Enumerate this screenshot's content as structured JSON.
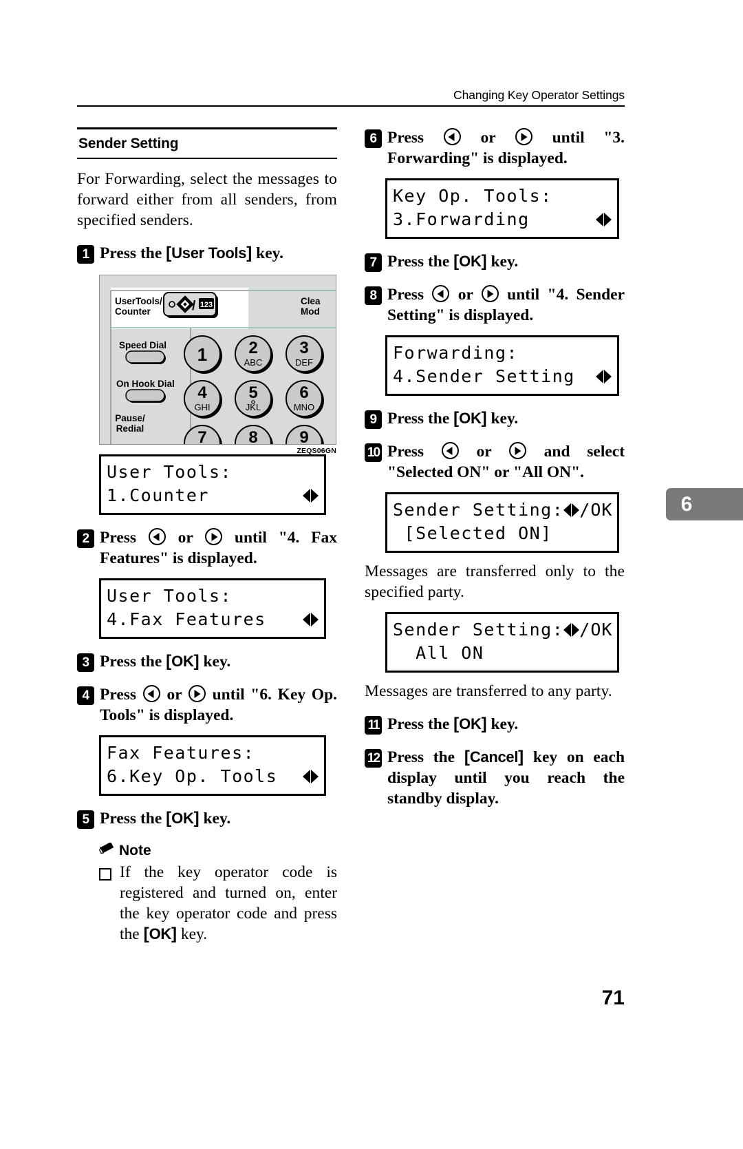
{
  "header": {
    "running_title": "Changing Key Operator Settings"
  },
  "chapter_tab": "6",
  "page_number": "71",
  "left_column": {
    "section_title": "Sender Setting",
    "intro_paragraph": "For Forwarding, select the messages to forward either from all senders, from specified senders.",
    "step1": {
      "num": "1",
      "text_before": "Press the",
      "key": "User Tools",
      "text_after": "key."
    },
    "illustration": {
      "caption": "ZEQS06GN",
      "label_user_tools": "UserTools/",
      "label_user_tools_2": "Counter",
      "label_clear": "Clea",
      "label_clear_2": "Mod",
      "label_speed_dial": "Speed Dial",
      "label_on_hook": "On Hook Dial",
      "label_pause": "Pause/",
      "label_pause_2": "Redial",
      "key_numeric_badge": "123",
      "keys": [
        {
          "digit": "1",
          "letters": ""
        },
        {
          "digit": "2",
          "letters": "ABC"
        },
        {
          "digit": "3",
          "letters": "DEF"
        },
        {
          "digit": "4",
          "letters": "GHI"
        },
        {
          "digit": "5",
          "letters": "JKL"
        },
        {
          "digit": "6",
          "letters": "MNO"
        },
        {
          "digit": "7",
          "letters": ""
        },
        {
          "digit": "8",
          "letters": ""
        },
        {
          "digit": "9",
          "letters": ""
        }
      ]
    },
    "lcd1": {
      "line1": "User Tools:",
      "line2": "1.Counter"
    },
    "step2": {
      "num": "2",
      "text_before": "Press",
      "text_mid": "or",
      "text_after": "until \"4. Fax Features\" is displayed."
    },
    "lcd2": {
      "line1": "User Tools:",
      "line2": "4.Fax Features"
    },
    "step3": {
      "num": "3",
      "text_before": "Press the",
      "key": "OK",
      "text_after": "key."
    },
    "step4": {
      "num": "4",
      "text_before": "Press",
      "text_mid": "or",
      "text_after": "until \"6. Key Op. Tools\" is displayed."
    },
    "lcd3": {
      "line1": "Fax Features:",
      "line2": "6.Key Op. Tools"
    },
    "step5": {
      "num": "5",
      "text_before": "Press the",
      "key": "OK",
      "text_after": "key."
    },
    "note": {
      "title": "Note",
      "item1_part1": "If the key operator code is registered and turned on, enter the key operator code and press the",
      "item1_key": "OK",
      "item1_part2": "key."
    }
  },
  "right_column": {
    "step6": {
      "num": "6",
      "text_before": "Press",
      "text_mid": "or",
      "text_after": "until \"3. Forwarding\" is displayed."
    },
    "lcd4": {
      "line1": "Key Op. Tools:",
      "line2": "3.Forwarding"
    },
    "step7": {
      "num": "7",
      "text_before": "Press the",
      "key": "OK",
      "text_after": "key."
    },
    "step8": {
      "num": "8",
      "text_before": "Press",
      "text_mid": "or",
      "text_after": "until \"4. Sender Setting\" is displayed."
    },
    "lcd5": {
      "line1": "Forwarding:",
      "line2": "4.Sender Setting"
    },
    "step9": {
      "num": "9",
      "text_before": "Press the",
      "key": "OK",
      "text_after": "key."
    },
    "step10": {
      "num": "10",
      "text_before": "Press",
      "text_mid": "or",
      "text_after": "and select \"Selected ON\" or \"All ON\"."
    },
    "lcd6": {
      "line1": "Sender Setting:",
      "line1_suffix": "/OK",
      "line2": " [Selected ON]"
    },
    "desc1": "Messages are transferred only to the specified party.",
    "lcd7": {
      "line1": "Sender Setting:",
      "line1_suffix": "/OK",
      "line2": "  All ON"
    },
    "desc2": "Messages are transferred to any party.",
    "step11": {
      "num": "11",
      "text_before": "Press the",
      "key": "OK",
      "text_after": "key."
    },
    "step12": {
      "num": "12",
      "text_before": "Press the",
      "key": "Cancel",
      "text_after": "key on each display until you reach the standby display."
    }
  }
}
